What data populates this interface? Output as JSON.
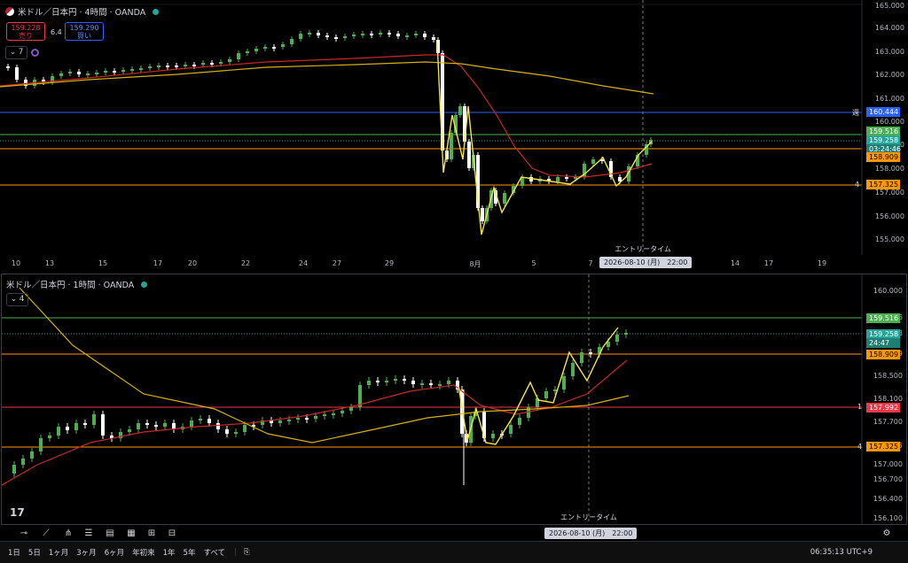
{
  "top_chart": {
    "title": "米ドル／日本円 · 4時間 · OANDA",
    "sell_price": "159.228",
    "sell_label": "売り",
    "spread": "6.4",
    "buy_price": "159.290",
    "buy_label": "買い",
    "indicator_count": "7",
    "y_ticks": [
      "165.000",
      "164.000",
      "163.000",
      "162.000",
      "161.000",
      "160.000",
      "159.000",
      "158.000",
      "157.000",
      "156.000",
      "155.000"
    ],
    "x_ticks": [
      "10",
      "13",
      "15",
      "17",
      "20",
      "22",
      "24",
      "27",
      "29",
      "8月",
      "5",
      "7",
      "14",
      "17",
      "19"
    ],
    "price_tags": [
      {
        "text": "160.444",
        "color": "#2962ff"
      },
      {
        "text": "159.516",
        "color": "#4caf50"
      },
      {
        "text": "159.258",
        "color": "#26a69a"
      },
      {
        "text": "03:24:46",
        "color": "#26a69a"
      },
      {
        "text": "158.909",
        "color": "#ff9800"
      },
      {
        "text": "157.325",
        "color": "#ff9800"
      }
    ],
    "left_markers": [
      "週",
      "4"
    ],
    "entry_label": "エントリータイム",
    "crosshair_date": "2026-08-10 (月)　22:00"
  },
  "bottom_chart": {
    "title": "米ドル／日本円 · 1時間 · OANDA",
    "indicator_count": "4",
    "y_ticks": [
      "160.000",
      "159.516",
      "159.258",
      "158.909",
      "158.500",
      "158.100",
      "157.700",
      "157.325",
      "157.000",
      "156.700",
      "156.400",
      "156.100"
    ],
    "x_ticks": [
      "18:00",
      "6",
      "06:00",
      "12:00",
      "18:00",
      "7",
      "06:00",
      "12:00",
      "18:00",
      "8",
      "10",
      "12:00",
      "18:00",
      "12",
      "06:00",
      "12:00",
      "18:00",
      "13",
      "06:"
    ],
    "price_tags": [
      {
        "text": "159.516",
        "color": "#4caf50"
      },
      {
        "text": "159.258",
        "color": "#26a69a"
      },
      {
        "text": "24:47",
        "color": "#26a69a"
      },
      {
        "text": "158.909",
        "color": "#ff9800"
      },
      {
        "text": "157.992",
        "color": "#f23645"
      },
      {
        "text": "157.325",
        "color": "#ff9800"
      }
    ],
    "left_markers": [
      "1",
      "4"
    ],
    "entry_label": "エントリータイム",
    "crosshair_date": "2026-08-10 (月)　22:00"
  },
  "range_buttons": [
    "1日",
    "5日",
    "1ヶ月",
    "3ヶ月",
    "6ヶ月",
    "年初来",
    "1年",
    "5年",
    "すべて"
  ],
  "clock": "06:35:13 UTC+9",
  "colors": {
    "up": "#4caf50",
    "down": "#ffffff",
    "ema_fast": "#c62828",
    "ema_slow": "#d4b106",
    "zigzag": "#f5e34a"
  }
}
